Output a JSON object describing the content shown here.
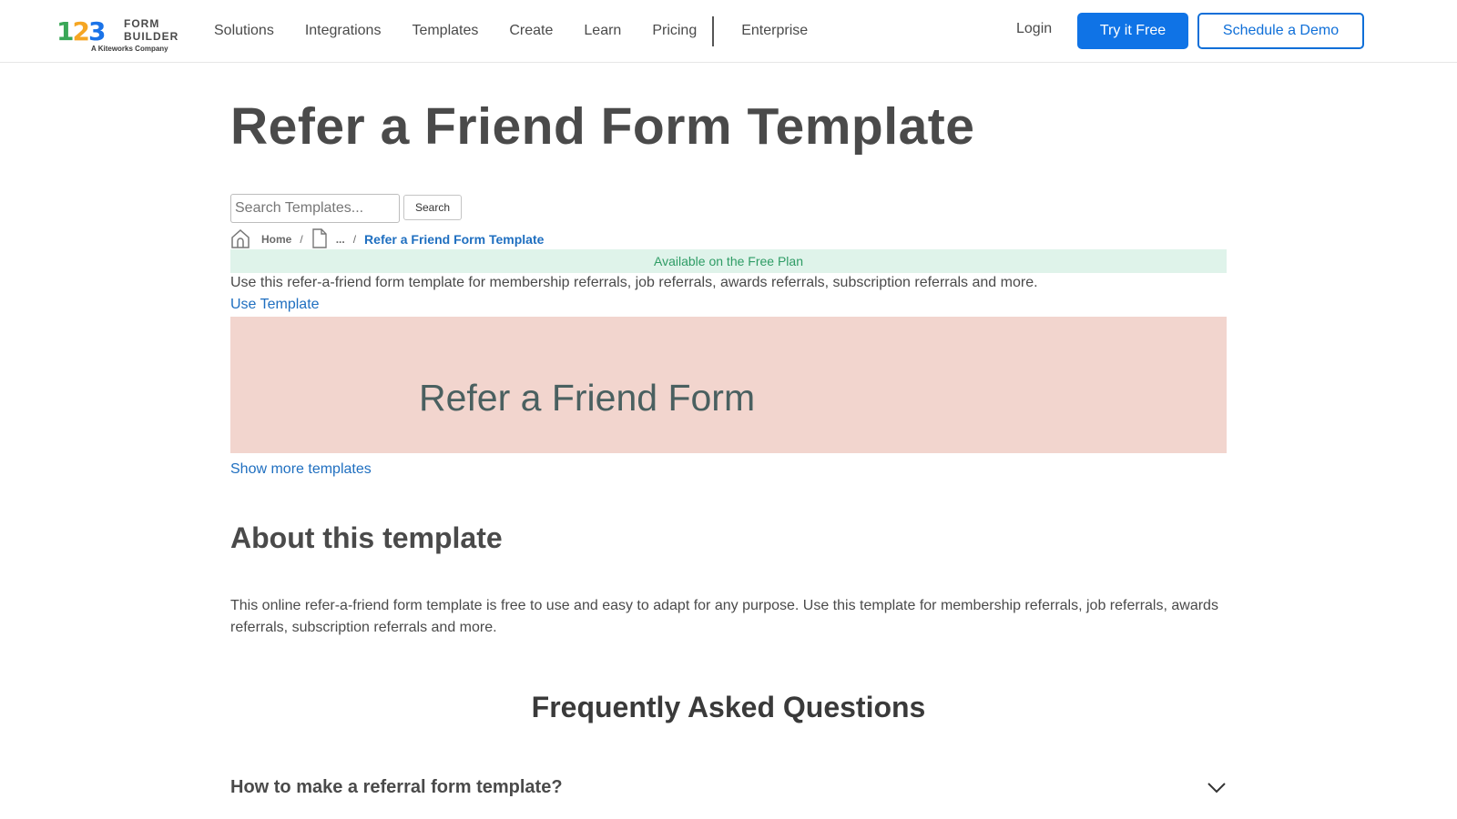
{
  "logo": {
    "digits": [
      "1",
      "2",
      "3"
    ],
    "word_line1": "FORM",
    "word_line2": "BUILDER",
    "tagline": "A Kiteworks Company",
    "colors": {
      "one": "#3aa757",
      "two": "#f5a623",
      "three": "#1a73e8"
    }
  },
  "nav": {
    "items": [
      "Solutions",
      "Integrations",
      "Templates",
      "Create",
      "Learn",
      "Pricing"
    ],
    "enterprise": "Enterprise"
  },
  "header_actions": {
    "login": "Login",
    "try_free": "Try it Free",
    "schedule_demo": "Schedule a Demo"
  },
  "page": {
    "title": "Refer a Friend Form Template"
  },
  "search": {
    "placeholder": "Search Templates...",
    "value": "",
    "button": "Search"
  },
  "breadcrumb": {
    "home": "Home",
    "separator": "/",
    "ellipsis": "...",
    "current": "Refer a Friend Form Template"
  },
  "plan_badge": "Available on the Free Plan",
  "description": "Use this refer-a-friend form template for membership referrals, job referrals, awards referrals, subscription referrals and more.",
  "use_template": "Use Template",
  "preview": {
    "title": "Refer a Friend Form",
    "background": "#f2d5ce"
  },
  "show_more": "Show more templates",
  "about": {
    "heading": "About this template",
    "text": "This online refer-a-friend form template is free to use and easy to adapt for any purpose. Use this template for membership referrals, job referrals, awards referrals, subscription referrals and more."
  },
  "faq": {
    "heading": "Frequently Asked Questions",
    "items": [
      {
        "question": "How to make a referral form template?",
        "icon": "chevron-down-icon"
      }
    ]
  },
  "colors": {
    "accent": "#0f73e6",
    "link": "#1f6fc0",
    "badge_bg": "#dff3ea",
    "badge_text": "#2e9c65",
    "text": "#4a4a4a"
  }
}
